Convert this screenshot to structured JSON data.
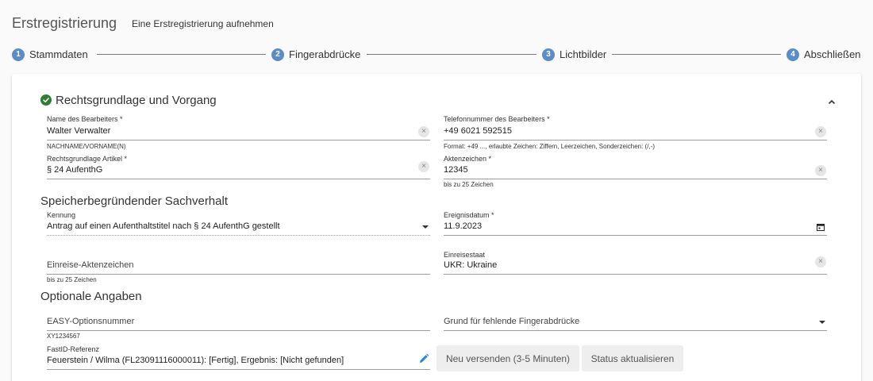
{
  "header": {
    "title": "Erstregistrierung",
    "subtitle": "Eine Erstregistrierung aufnehmen"
  },
  "stepper": [
    {
      "number": "1",
      "label": "Stammdaten"
    },
    {
      "number": "2",
      "label": "Fingerabdrücke"
    },
    {
      "number": "3",
      "label": "Lichtbilder"
    },
    {
      "number": "4",
      "label": "Abschließen"
    }
  ],
  "sections": {
    "legal": {
      "title": "Rechtsgrundlage und Vorgang",
      "status_icon": "check-circle-icon",
      "status_color": "#2e7d32"
    },
    "facts": {
      "title": "Speicherbegründender Sachverhalt"
    },
    "optional": {
      "title": "Optionale Angaben"
    }
  },
  "fields": {
    "officer_name": {
      "label": "Name des Bearbeiters *",
      "value": "Walter Verwalter",
      "hint": "NACHNAME/VORNAME(N)"
    },
    "officer_phone": {
      "label": "Telefonnummer des Bearbeiters *",
      "value": "+49 6021 592515",
      "hint": "Format: +49 ..., erlaubte Zeichen: Ziffern, Leerzeichen, Sonderzeichen: (/,-)"
    },
    "legal_article": {
      "label": "Rechtsgrundlage Artikel *",
      "value": "§ 24 AufenthG"
    },
    "file_number": {
      "label": "Aktenzeichen *",
      "value": "12345",
      "hint": "bis zu 25 Zeichen"
    },
    "identifier": {
      "label": "Kennung",
      "value": "Antrag auf einen Aufenthaltstitel nach § 24 AufenthG gestellt"
    },
    "event_date": {
      "label": "Ereignisdatum *",
      "value": "11.9.2023"
    },
    "entry_file_number": {
      "placeholder": "Einreise-Aktenzeichen",
      "hint": "bis zu 25 Zeichen"
    },
    "entry_state": {
      "label": "Einreisestaat",
      "value": "UKR: Ukraine"
    },
    "easy_option": {
      "placeholder": "EASY-Optionsnummer",
      "hint": "XY1234567"
    },
    "missing_fingerprints_reason": {
      "placeholder": "Grund für fehlende Fingerabdrücke"
    },
    "fastid": {
      "label": "FastID-Referenz",
      "value": "Feuerstein / Wilma (FL23091116000011): [Fertig], Ergebnis: [Nicht gefunden]"
    }
  },
  "buttons": {
    "resend": "Neu versenden (3-5 Minuten)",
    "refresh_status": "Status aktualisieren"
  },
  "colors": {
    "step_accent": "#5b8cc7",
    "edit_icon": "#1e88e5"
  }
}
